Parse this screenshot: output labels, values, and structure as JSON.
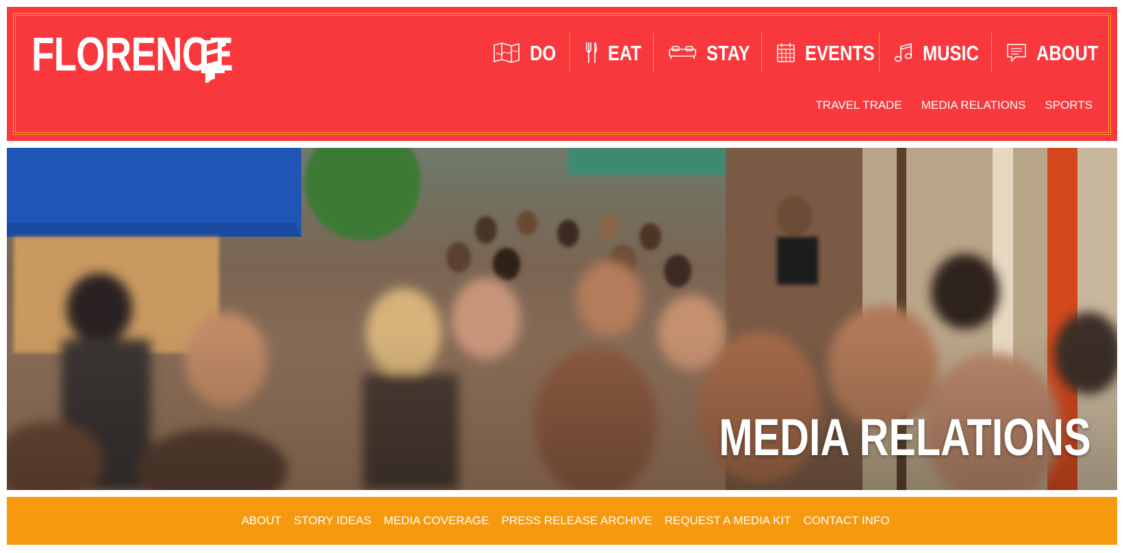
{
  "brand": {
    "logo_text": "FLORENCE",
    "logo_mark_icon": "alabama-state-icon"
  },
  "colors": {
    "header_bg": "#f8383d",
    "accent": "#f7a11b",
    "section_nav_bg": "#f7990f",
    "text": "#ffffff"
  },
  "main_nav": [
    {
      "label": "DO",
      "icon": "map-icon"
    },
    {
      "label": "EAT",
      "icon": "fork-knife-icon"
    },
    {
      "label": "STAY",
      "icon": "bed-icon"
    },
    {
      "label": "EVENTS",
      "icon": "calendar-icon"
    },
    {
      "label": "MUSIC",
      "icon": "music-note-icon"
    },
    {
      "label": "ABOUT",
      "icon": "chat-icon"
    }
  ],
  "sub_nav": [
    "TRAVEL TRADE",
    "MEDIA RELATIONS",
    "SPORTS"
  ],
  "hero": {
    "title": "MEDIA RELATIONS",
    "image": "crowd-photo"
  },
  "section_nav": [
    "ABOUT",
    "STORY IDEAS",
    "MEDIA COVERAGE",
    "PRESS RELEASE ARCHIVE",
    "REQUEST A MEDIA KIT",
    "CONTACT INFO"
  ]
}
